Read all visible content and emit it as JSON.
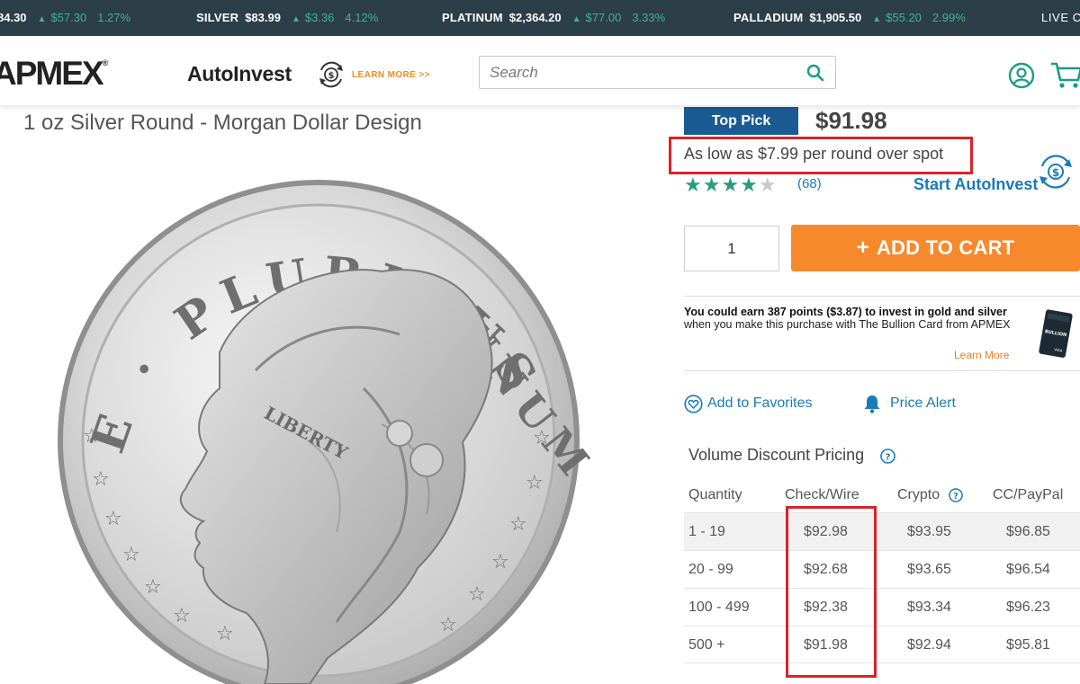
{
  "ticker": {
    "gold_fragment": {
      "price": "84.30",
      "change": "$57.30",
      "percent": "1.27%"
    },
    "items": [
      {
        "name": "SILVER",
        "price": "$83.99",
        "change": "$3.36",
        "percent": "4.12%"
      },
      {
        "name": "PLATINUM",
        "price": "$2,364.20",
        "change": "$77.00",
        "percent": "3.33%"
      },
      {
        "name": "PALLADIUM",
        "price": "$1,905.50",
        "change": "$55.20",
        "percent": "2.99%"
      }
    ],
    "live_label": "LIVE C",
    "up_color": "#3fb68b"
  },
  "header": {
    "logo": "APMEX",
    "logo_mark": "®",
    "autoinvest_label": "AutoInvest",
    "learn_more": "LEARN MORE >>",
    "search_placeholder": "Search"
  },
  "product": {
    "title": "1 oz Silver Round - Morgan Dollar Design",
    "coin_legend_left": "E · PLURIBUS",
    "coin_legend_right": "UNUM",
    "coin_headband": "LIBERTY",
    "badge": "Top Pick",
    "price": "$91.98",
    "low_price_text": "As low as $7.99 per round over spot",
    "rating_stars": 4.5,
    "review_count": "(68)",
    "start_autoinvest": "Start AutoInvest",
    "quantity": "1",
    "add_to_cart": "ADD TO CART",
    "add_to_cart_plus": "+"
  },
  "rewards": {
    "bold_text": "You could earn 387 points ($3.87) to invest in gold and silver",
    "rest_text": " when you make this purchase with The Bullion Card from APMEX",
    "learn_more": "Learn More",
    "card_text": "BULLION",
    "card_network": "VISA"
  },
  "actions": {
    "favorites": "Add to Favorites",
    "price_alert": "Price Alert"
  },
  "volume_pricing": {
    "title": "Volume Discount Pricing",
    "headers": [
      "Quantity",
      "Check/Wire",
      "Crypto",
      "CC/PayPal"
    ],
    "rows": [
      [
        "1 - 19",
        "$92.98",
        "$93.95",
        "$96.85"
      ],
      [
        "20 - 99",
        "$92.68",
        "$93.65",
        "$96.54"
      ],
      [
        "100 - 499",
        "$92.38",
        "$93.34",
        "$96.23"
      ],
      [
        "500 +",
        "$91.98",
        "$92.94",
        "$95.81"
      ]
    ]
  },
  "colors": {
    "ticker_bg": "#2c3e48",
    "brand_blue": "#1b5b93",
    "link_blue": "#1a7bb8",
    "accent_orange": "#f7892d",
    "star_green": "#2a9d7c",
    "highlight_red": "#d8232a"
  },
  "icons": [
    "autoinvest-dollar-cycle-icon",
    "search-icon",
    "account-icon",
    "cart-icon",
    "heart-icon",
    "bell-icon",
    "help-icon"
  ]
}
